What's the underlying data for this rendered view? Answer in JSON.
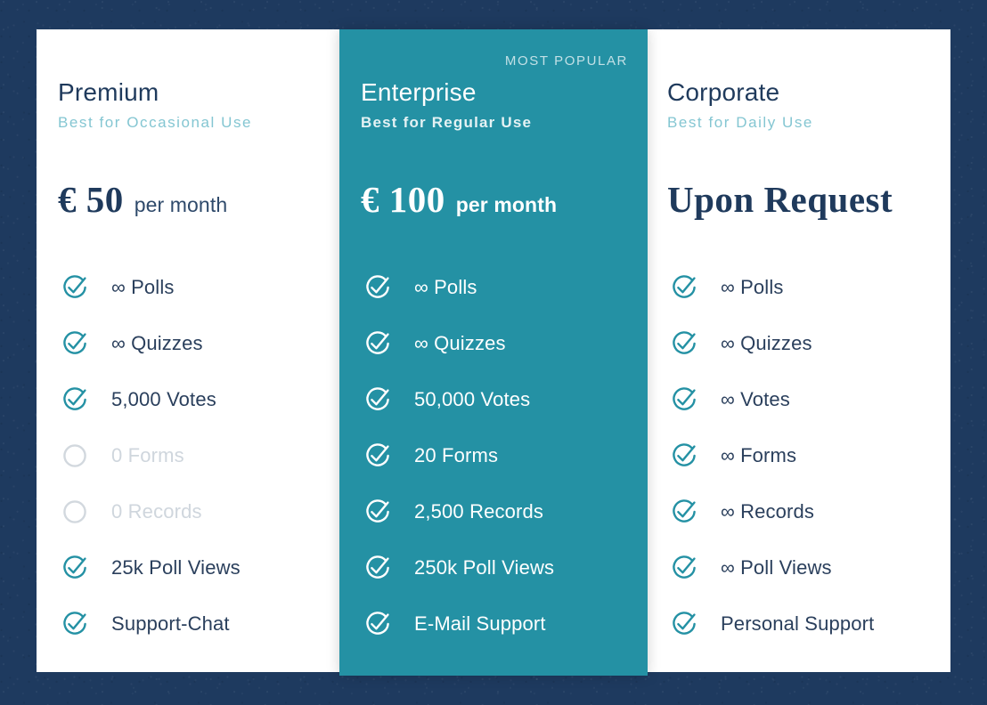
{
  "theme": {
    "background_color": "#1e3a5f",
    "card_background": "#ffffff",
    "featured_background": "#2491a4",
    "accent_color": "#2491a4",
    "heading_color": "#1f3a5c",
    "tagline_color": "#84c6d2",
    "disabled_color": "#cfd6dd"
  },
  "plans": [
    {
      "id": "premium",
      "name": "Premium",
      "tagline": "Best for Occasional Use",
      "badge": null,
      "price_amount": "€ 50",
      "price_period": "per month",
      "featured": false,
      "features": [
        {
          "label": "∞ Polls",
          "included": true,
          "icon": "check-circle-icon"
        },
        {
          "label": "∞ Quizzes",
          "included": true,
          "icon": "check-circle-icon"
        },
        {
          "label": "5,000 Votes",
          "included": true,
          "icon": "check-circle-icon"
        },
        {
          "label": "0 Forms",
          "included": false,
          "icon": "empty-circle-icon"
        },
        {
          "label": "0 Records",
          "included": false,
          "icon": "empty-circle-icon"
        },
        {
          "label": "25k Poll Views",
          "included": true,
          "icon": "check-circle-icon"
        },
        {
          "label": "Support-Chat",
          "included": true,
          "icon": "check-circle-icon"
        }
      ]
    },
    {
      "id": "enterprise",
      "name": "Enterprise",
      "tagline": "Best for Regular Use",
      "badge": "MOST POPULAR",
      "price_amount": "€ 100",
      "price_period": "per month",
      "featured": true,
      "features": [
        {
          "label": "∞ Polls",
          "included": true,
          "icon": "check-circle-icon"
        },
        {
          "label": "∞ Quizzes",
          "included": true,
          "icon": "check-circle-icon"
        },
        {
          "label": "50,000 Votes",
          "included": true,
          "icon": "check-circle-icon"
        },
        {
          "label": "20 Forms",
          "included": true,
          "icon": "check-circle-icon"
        },
        {
          "label": "2,500 Records",
          "included": true,
          "icon": "check-circle-icon"
        },
        {
          "label": "250k Poll Views",
          "included": true,
          "icon": "check-circle-icon"
        },
        {
          "label": "E-Mail Support",
          "included": true,
          "icon": "check-circle-icon"
        }
      ]
    },
    {
      "id": "corporate",
      "name": "Corporate",
      "tagline": "Best for Daily Use",
      "badge": null,
      "price_amount": "Upon Request",
      "price_period": "",
      "featured": false,
      "features": [
        {
          "label": "∞ Polls",
          "included": true,
          "icon": "check-circle-icon"
        },
        {
          "label": "∞ Quizzes",
          "included": true,
          "icon": "check-circle-icon"
        },
        {
          "label": "∞ Votes",
          "included": true,
          "icon": "check-circle-icon"
        },
        {
          "label": "∞ Forms",
          "included": true,
          "icon": "check-circle-icon"
        },
        {
          "label": "∞ Records",
          "included": true,
          "icon": "check-circle-icon"
        },
        {
          "label": "∞ Poll Views",
          "included": true,
          "icon": "check-circle-icon"
        },
        {
          "label": "Personal Support",
          "included": true,
          "icon": "check-circle-icon"
        }
      ]
    }
  ]
}
